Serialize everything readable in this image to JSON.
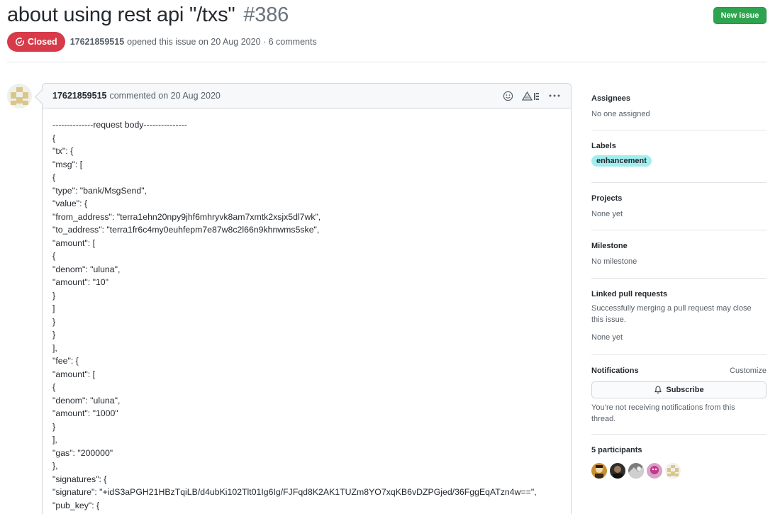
{
  "issue": {
    "title": "about using rest api \"/txs\"",
    "number": "#386",
    "state": "Closed",
    "author": "17621859515",
    "opened_text": "opened this issue on 20 Aug 2020 · 6 comments",
    "new_issue_label": "New issue",
    "state_color": "#d73a49",
    "new_issue_color": "#2ea44f"
  },
  "comment": {
    "author": "17621859515",
    "commented_text": "commented on 20 Aug 2020",
    "icons": [
      "smiley-icon",
      "triangle-ruler-icon",
      "kebab-horizontal-icon"
    ],
    "lines": [
      "--------------request body---------------",
      "{",
      "\"tx\": {",
      "\"msg\": [",
      "{",
      "\"type\": \"bank/MsgSend\",",
      "\"value\": {",
      "\"from_address\": \"terra1ehn20npy9jhf6mhryvk8am7xmtk2xsjx5dl7wk\",",
      "\"to_address\": \"terra1fr6c4my0euhfepm7e87w8c2l66n9khnwms5ske\",",
      "\"amount\": [",
      "{",
      "\"denom\": \"uluna\",",
      "\"amount\": \"10\"",
      "}",
      "]",
      "}",
      "}",
      "],",
      "\"fee\": {",
      "\"amount\": [",
      "{",
      "\"denom\": \"uluna\",",
      "\"amount\": \"1000\"",
      "}",
      "],",
      "\"gas\": \"200000\"",
      "},",
      "\"signatures\": {",
      "\"signature\": \"+idS3aPGH21HBzTqiLB/d4ubKi102Tlt01Ig6Ig/FJFqd8K2AK1TUZm8YO7xqKB6vDZPGjed/36FggEqATzn4w==\",",
      "\"pub_key\": {"
    ]
  },
  "sidebar": {
    "assignees": {
      "heading": "Assignees",
      "value": "No one assigned"
    },
    "labels": {
      "heading": "Labels",
      "items": [
        "enhancement"
      ],
      "color": "#a2eeef"
    },
    "projects": {
      "heading": "Projects",
      "value": "None yet"
    },
    "milestone": {
      "heading": "Milestone",
      "value": "No milestone"
    },
    "linked": {
      "heading": "Linked pull requests",
      "description": "Successfully merging a pull request may close this issue.",
      "value": "None yet"
    },
    "notifications": {
      "heading": "Notifications",
      "customize": "Customize",
      "subscribe_label": "Subscribe",
      "status": "You’re not receiving notifications from this thread."
    },
    "participants": {
      "heading": "5 participants",
      "count": 5
    }
  }
}
